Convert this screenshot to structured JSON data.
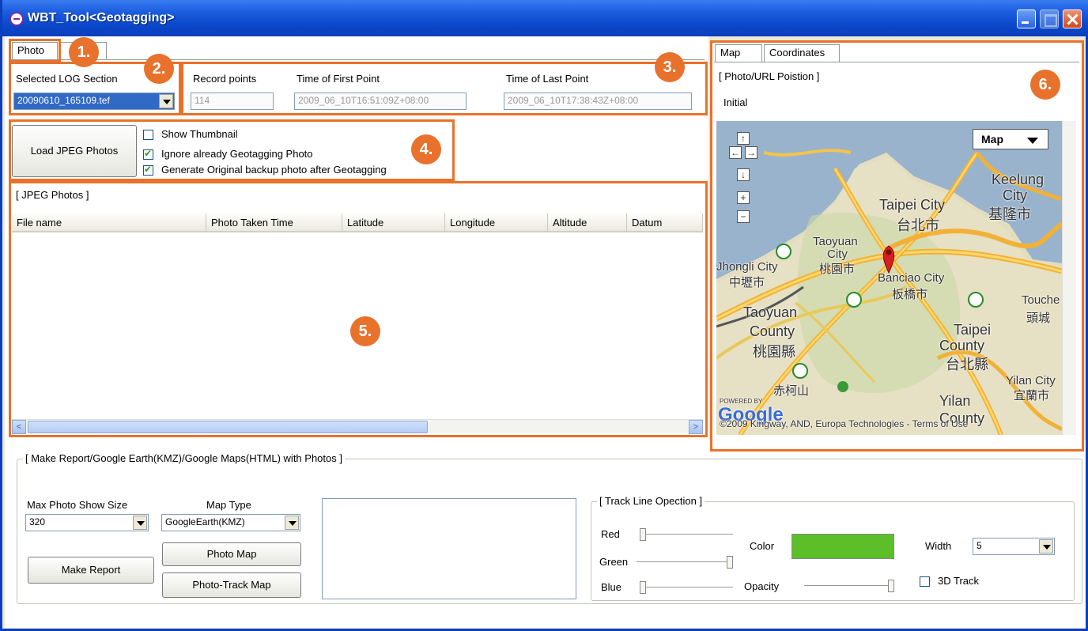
{
  "window": {
    "title": "WBT_Tool<Geotagging>"
  },
  "badges": {
    "b1": "1.",
    "b2": "2.",
    "b3": "3.",
    "b4": "4.",
    "b5": "5.",
    "b6": "6."
  },
  "left_tabs": {
    "photo": "Photo"
  },
  "log_section": {
    "label": "Selected LOG Section",
    "value": "20090610_165109.tef"
  },
  "record": {
    "points_label": "Record points",
    "points_value": "114",
    "first_label": "Time of First Point",
    "first_value": "2009_06_10T16:51:09Z+08:00",
    "last_label": "Time of Last Point",
    "last_value": "2009_06_10T17:38:43Z+08:00"
  },
  "load": {
    "button": "Load JPEG Photos",
    "opt_thumb": "Show Thumbnail",
    "opt_ignore": "Ignore already Geotagging Photo",
    "opt_backup": "Generate Original backup photo after Geotagging"
  },
  "photos": {
    "title": "[ JPEG Photos ]",
    "columns": [
      "File name",
      "Photo Taken Time",
      "Latitude",
      "Longitude",
      "Altitude",
      "Datum"
    ],
    "scroll_left": "<",
    "scroll_right": ">"
  },
  "map_panel": {
    "tab_map": "Map",
    "tab_coords": "Coordinates",
    "position_label": "[ Photo/URL Poistion ]",
    "position_value": "Initial",
    "map_type": "Map",
    "labels": {
      "keelung": "Keelung",
      "keelung_city": "City",
      "keelung_zh": "基隆市",
      "taipei_city": "Taipei City",
      "taipei_city_zh": "台北市",
      "taoyuan": "Taoyuan",
      "taoyuan_city": "City",
      "taoyuan_zh": "桃園市",
      "zhongli": "Jhongli City",
      "zhongli_zh": "中壢市",
      "banciao": "Banciao City",
      "banciao_zh": "板橋市",
      "touche": "Touche",
      "touche_zh": "頭城",
      "taoyuan_county": "Taoyuan",
      "county": "County",
      "taoyuan_county_zh": "桃園縣",
      "taipei_county": "Taipei",
      "taipei_county2": "County",
      "taipei_county_zh": "台北縣",
      "yilan_city": "Yilan City",
      "yilan_city_zh": "宜蘭市",
      "yilan": "Yilan",
      "yilan_county": "County",
      "mountain": "赤柯山",
      "powered": "POWERED BY",
      "google": "Google",
      "copyright": "©2009 Kingway, AND, Europa Technologies - Terms of Use"
    },
    "nav": {
      "up": "↑",
      "left": "←",
      "right": "→",
      "down": "↓",
      "zoom_in": "+",
      "zoom_out": "−"
    }
  },
  "report": {
    "group_title": "[ Make Report/Google Earth(KMZ)/Google Maps(HTML) with Photos ]",
    "max_size_label": "Max Photo Show Size",
    "max_size_value": "320",
    "map_type_label": "Map Type",
    "map_type_value": "GoogleEarth(KMZ)",
    "make_report": "Make Report",
    "photo_map": "Photo Map",
    "photo_track_map": "Photo-Track Map"
  },
  "track": {
    "group_title": "[ Track Line Opection ]",
    "red": "Red",
    "green": "Green",
    "blue": "Blue",
    "color_label": "Color",
    "opacity_label": "Opacity",
    "width_label": "Width",
    "width_value": "5",
    "track3d": "3D Track",
    "color_value": "#5cbf2a",
    "red_level": 0.0,
    "green_level": 1.0,
    "blue_level": 0.0,
    "opacity_level": 1.0
  }
}
